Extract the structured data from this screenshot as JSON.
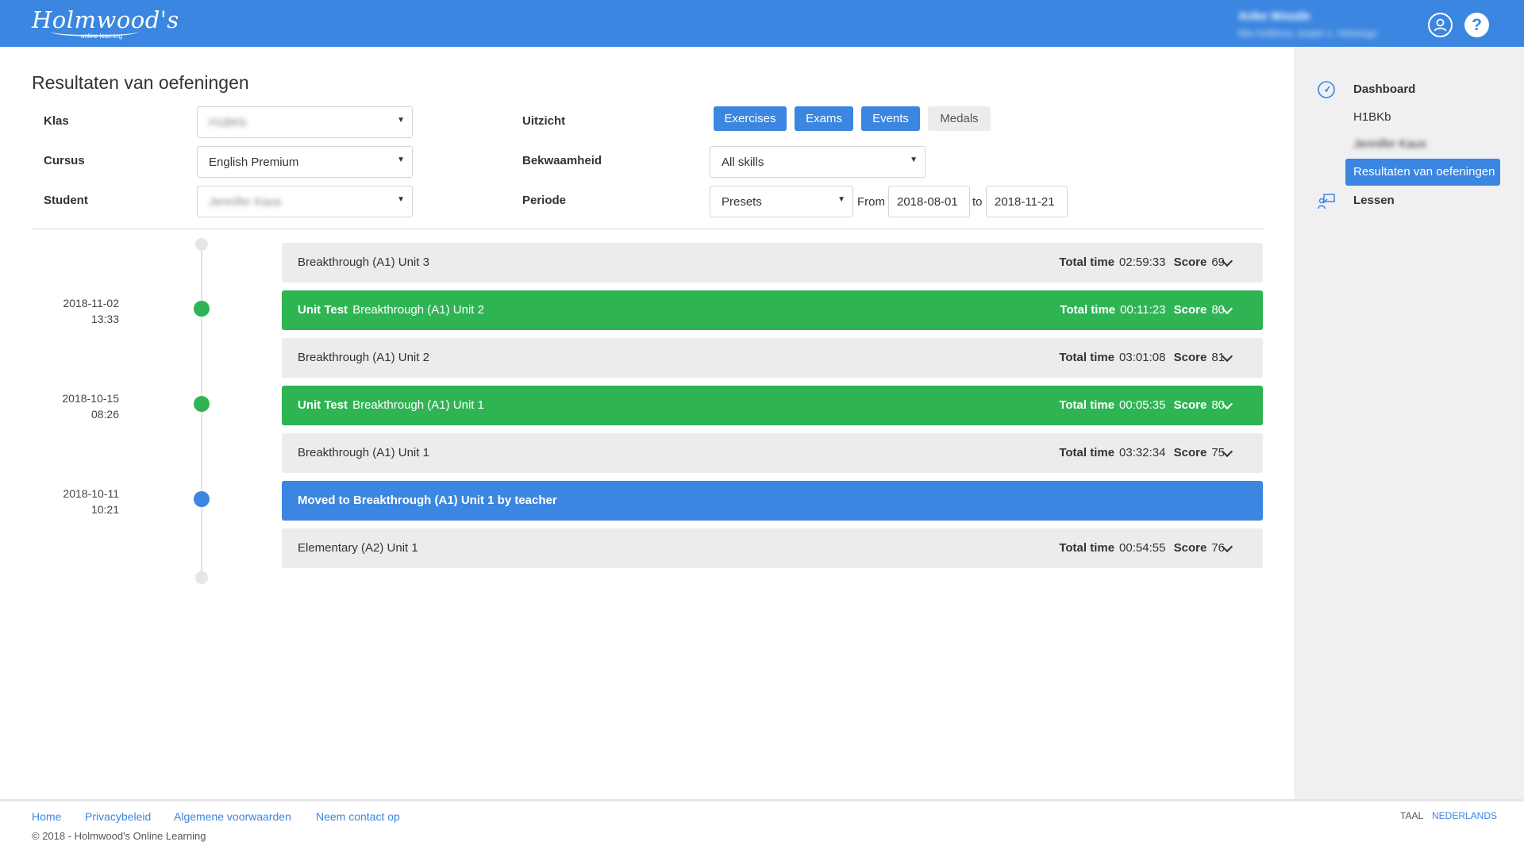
{
  "header": {
    "logo_text": "Holmwood's",
    "logo_sub": "online learning",
    "user_name": "Anke Woude",
    "user_sub": "Mw Holbloos, leader s. Histologe",
    "help_label": "?"
  },
  "page": {
    "title": "Resultaten van oefeningen"
  },
  "filters": {
    "klas_label": "Klas",
    "klas_value": "H1BKb",
    "cursus_label": "Cursus",
    "cursus_value": "English Premium",
    "student_label": "Student",
    "student_value": "Jennifer Kaus",
    "uitzicht_label": "Uitzicht",
    "bekwaamheid_label": "Bekwaamheid",
    "bekwaamheid_value": "All skills",
    "periode_label": "Periode",
    "presets_value": "Presets",
    "from_label": "From",
    "from_value": "2018-08-01",
    "to_label": "to",
    "to_value": "2018-11-21",
    "view_buttons": [
      {
        "label": "Exercises",
        "active": true
      },
      {
        "label": "Exams",
        "active": true
      },
      {
        "label": "Events",
        "active": true
      },
      {
        "label": "Medals",
        "active": false
      }
    ]
  },
  "timeline": {
    "dates": [
      {
        "date": "2018-11-02",
        "time": "13:33",
        "color": "#2fb454"
      },
      {
        "date": "2018-10-15",
        "time": "08:26",
        "color": "#2fb454"
      },
      {
        "date": "2018-10-11",
        "time": "10:21",
        "color": "#3b86e0"
      }
    ],
    "total_time_label": "Total time",
    "score_label": "Score",
    "rows": [
      {
        "type": "gray",
        "prefix": "",
        "title": "Breakthrough (A1) Unit 3",
        "total_time": "02:59:33",
        "score": "69"
      },
      {
        "type": "green",
        "prefix": "Unit Test",
        "title": "Breakthrough (A1) Unit 2",
        "total_time": "00:11:23",
        "score": "80"
      },
      {
        "type": "gray",
        "prefix": "",
        "title": "Breakthrough (A1) Unit 2",
        "total_time": "03:01:08",
        "score": "81"
      },
      {
        "type": "green",
        "prefix": "Unit Test",
        "title": "Breakthrough (A1) Unit 1",
        "total_time": "00:05:35",
        "score": "80"
      },
      {
        "type": "gray",
        "prefix": "",
        "title": "Breakthrough (A1) Unit 1",
        "total_time": "03:32:34",
        "score": "75"
      },
      {
        "type": "blue",
        "prefix": "",
        "title": "Moved to Breakthrough (A1) Unit 1 by teacher",
        "total_time": "",
        "score": ""
      },
      {
        "type": "gray",
        "prefix": "",
        "title": "Elementary (A2) Unit 1",
        "total_time": "00:54:55",
        "score": "76"
      }
    ]
  },
  "sidebar": {
    "dashboard": "Dashboard",
    "class_item": "H1BKb",
    "student_item": "Jennifer Kaus",
    "active_item": "Resultaten van oefeningen",
    "lessen": "Lessen"
  },
  "footer": {
    "links": [
      "Home",
      "Privacybeleid",
      "Algemene voorwaarden",
      "Neem contact op"
    ],
    "copyright": "© 2018 - Holmwood's Online Learning",
    "taal_label": "TAAL",
    "taal_value": "NEDERLANDS"
  },
  "colors": {
    "brand_blue": "#3b86e0",
    "success_green": "#2fb454",
    "row_gray": "#ececef"
  }
}
